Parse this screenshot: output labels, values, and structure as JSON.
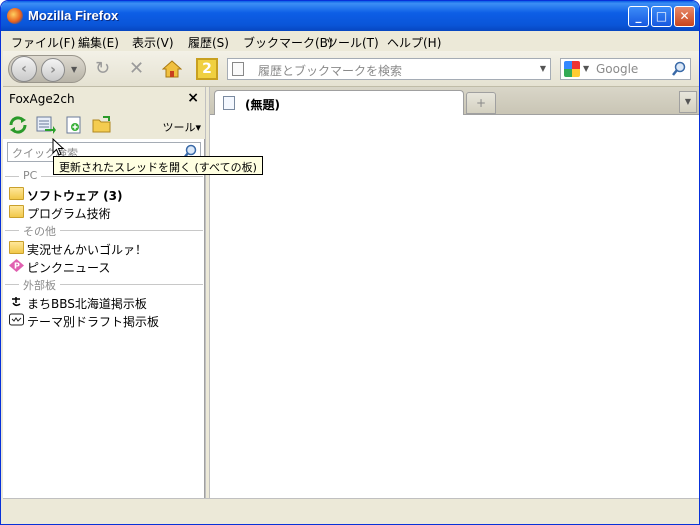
{
  "window": {
    "title": "Mozilla Firefox"
  },
  "menu": [
    "ファイル(F)",
    "編集(E)",
    "表示(V)",
    "履歴(S)",
    "ブックマーク(B)",
    "ツール(T)",
    "ヘルプ(H)"
  ],
  "toolbar": {
    "badge": "2",
    "url_placeholder": "履歴とブックマークを検索",
    "search_engine": "Google"
  },
  "sidebar": {
    "title": "FoxAge2ch",
    "tools_label": "ツール",
    "filter_placeholder": "クイック検索",
    "groups": [
      {
        "label": "PC",
        "items": [
          {
            "name": "ソフトウェア (3)",
            "bold": true,
            "icon": "folder-icon"
          },
          {
            "name": "プログラム技術",
            "bold": false,
            "icon": "folder-icon"
          }
        ]
      },
      {
        "label": "その他",
        "items": [
          {
            "name": "実況せんかいゴルァ！",
            "bold": false,
            "icon": "folder-icon"
          },
          {
            "name": "ピンクニュース",
            "bold": false,
            "icon": "pink-icon"
          }
        ]
      },
      {
        "label": "外部板",
        "items": [
          {
            "name": "まちBBS北海道掲示板",
            "bold": false,
            "icon": "ma-icon"
          },
          {
            "name": "テーマ別ドラフト掲示板",
            "bold": false,
            "icon": "board-icon"
          }
        ]
      }
    ]
  },
  "tooltip": "更新されたスレッドを開く (すべての板)",
  "tabs": [
    {
      "label": "(無題)"
    }
  ]
}
